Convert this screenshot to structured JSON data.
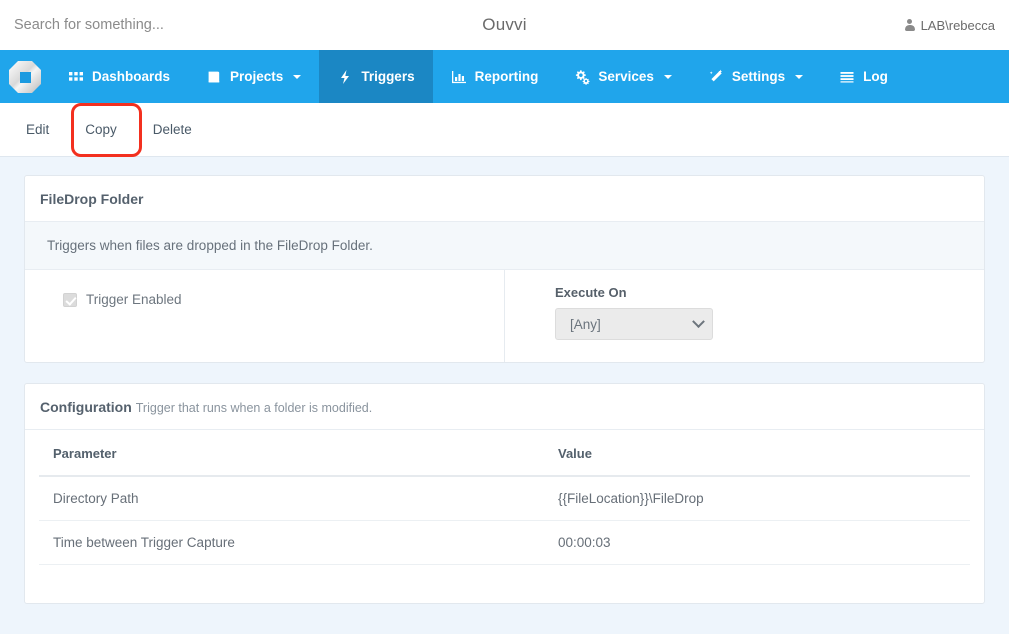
{
  "header": {
    "search": {
      "placeholder": "Search for something...",
      "value": "",
      "icon": "search-icon"
    },
    "title": "Ouvvi",
    "user": {
      "name": "LAB\\rebecca",
      "icon": "user-icon"
    }
  },
  "nav": {
    "logo": "ouvvi-logo",
    "items": [
      {
        "label": "Dashboards",
        "icon": "grid-icon",
        "active": false,
        "caret": false
      },
      {
        "label": "Projects",
        "icon": "book-icon",
        "active": false,
        "caret": true
      },
      {
        "label": "Triggers",
        "icon": "lightning-bolt-icon",
        "active": true,
        "caret": false
      },
      {
        "label": "Reporting",
        "icon": "bar-chart-icon",
        "active": false,
        "caret": false
      },
      {
        "label": "Services",
        "icon": "gears-icon",
        "active": false,
        "caret": true
      },
      {
        "label": "Settings",
        "icon": "magic-wand-icon",
        "active": false,
        "caret": true
      },
      {
        "label": "Log",
        "icon": "list-lines-icon",
        "active": false,
        "caret": false
      }
    ]
  },
  "actions": {
    "edit": "Edit",
    "copy": "Copy",
    "delete": "Delete",
    "highlighted": "Copy",
    "highlight_color": "#f3301f"
  },
  "trigger_panel": {
    "title": "FileDrop Folder",
    "description": "Triggers when files are dropped in the FileDrop Folder.",
    "enabled_label": "Trigger Enabled",
    "enabled_checked": true,
    "execute_on_label": "Execute On",
    "execute_on_value": "[Any]"
  },
  "config_panel": {
    "title": "Configuration",
    "subtitle": "Trigger that runs when a folder is modified.",
    "columns": [
      "Parameter",
      "Value"
    ],
    "rows": [
      {
        "parameter": "Directory Path",
        "value": "{{FileLocation}}\\FileDrop"
      },
      {
        "parameter": "Time between Trigger Capture",
        "value": "00:00:03"
      }
    ]
  },
  "colors": {
    "nav": "#20a5eb",
    "nav_active": "#1b87c4",
    "page_bg": "#eef5fc",
    "panel_bg": "#ffffff",
    "accent_red": "#f3301f"
  }
}
